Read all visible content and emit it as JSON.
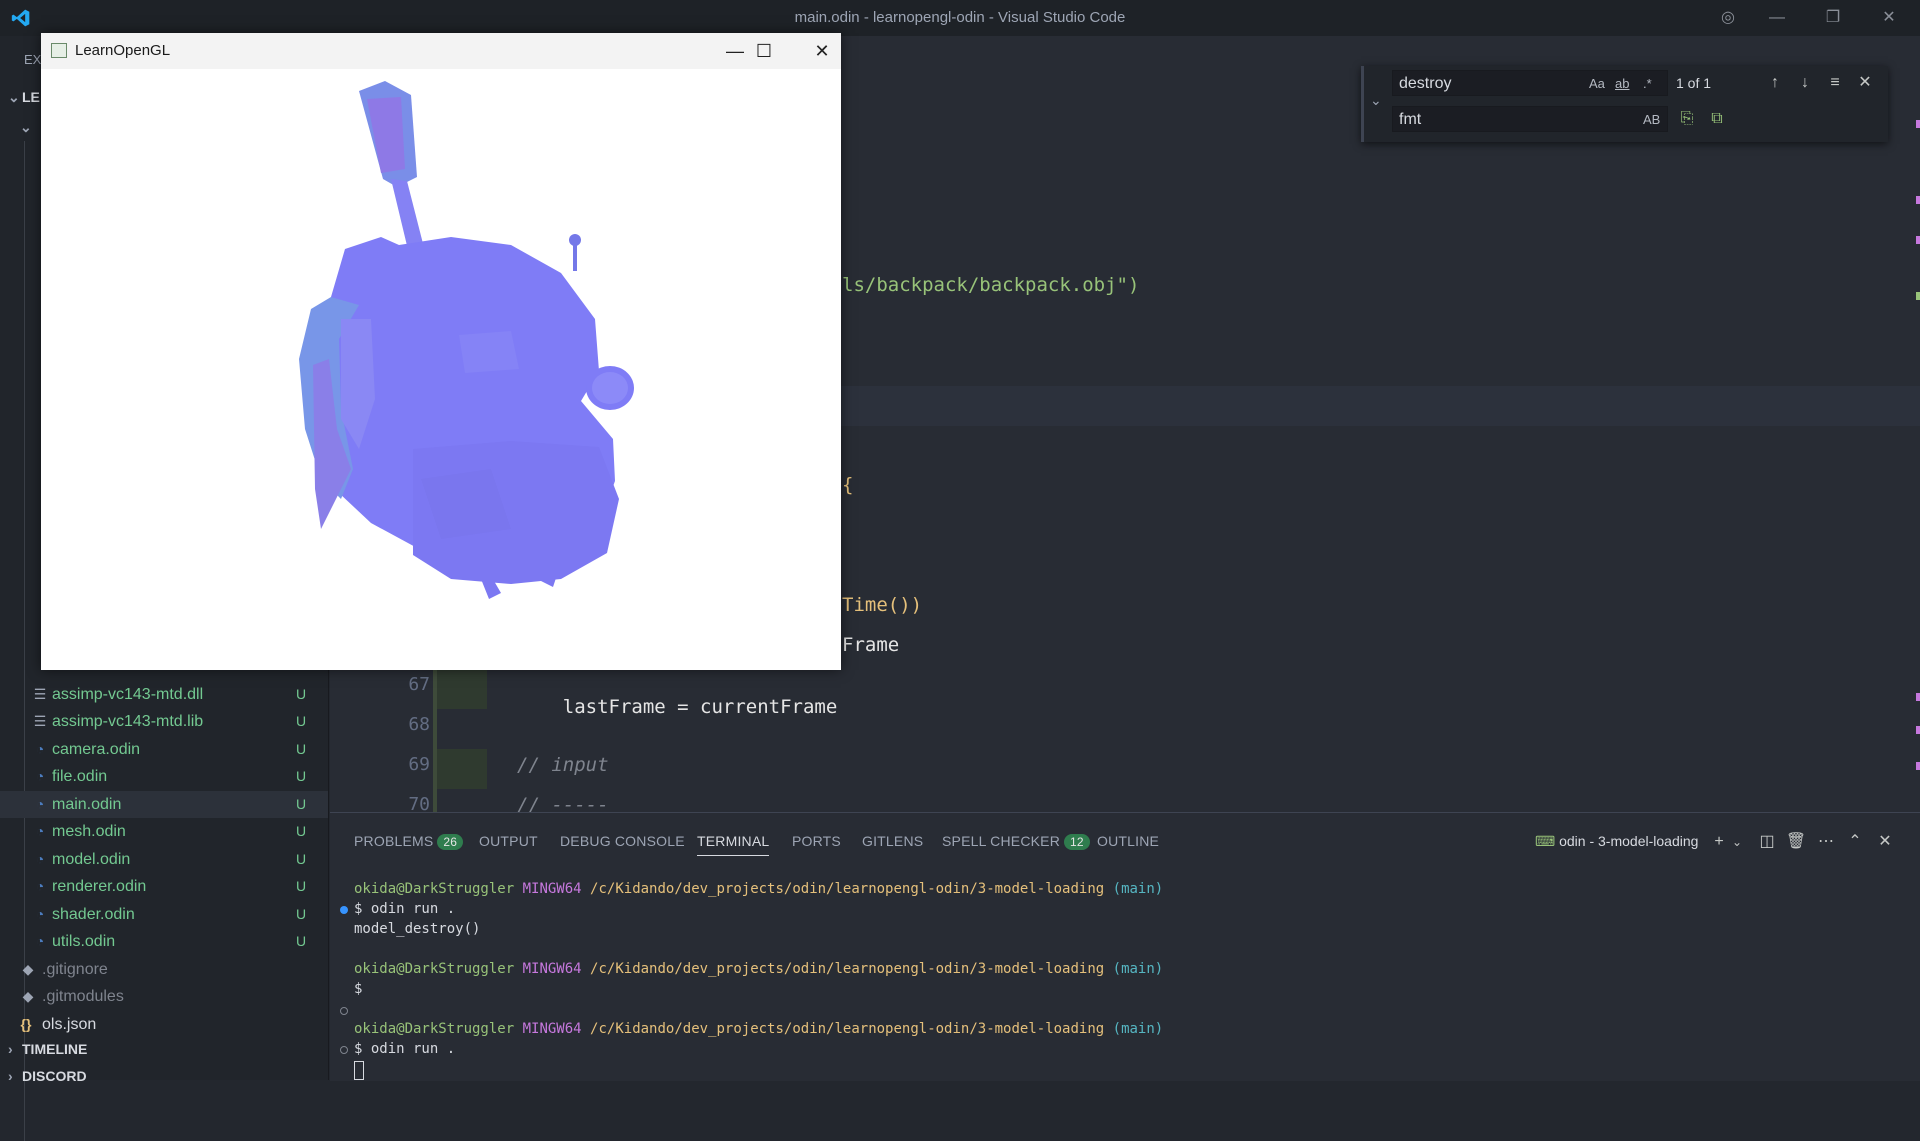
{
  "window": {
    "title": "main.odin - learnopengl-odin - Visual Studio Code"
  },
  "sidebar": {
    "title": "EX",
    "section_prefix": "LE",
    "files": [
      {
        "name": "assimp-vc143-mtd.dll",
        "status": "U",
        "icon": "file-lines-icon"
      },
      {
        "name": "assimp-vc143-mtd.lib",
        "status": "U",
        "icon": "file-lines-icon"
      },
      {
        "name": "camera.odin",
        "status": "U",
        "icon": "odin-icon"
      },
      {
        "name": "file.odin",
        "status": "U",
        "icon": "odin-icon"
      },
      {
        "name": "main.odin",
        "status": "U",
        "icon": "odin-icon",
        "selected": true
      },
      {
        "name": "mesh.odin",
        "status": "U",
        "icon": "odin-icon"
      },
      {
        "name": "model.odin",
        "status": "U",
        "icon": "odin-icon"
      },
      {
        "name": "renderer.odin",
        "status": "U",
        "icon": "odin-icon"
      },
      {
        "name": "shader.odin",
        "status": "U",
        "icon": "odin-icon"
      },
      {
        "name": "utils.odin",
        "status": "U",
        "icon": "odin-icon"
      },
      {
        "name": ".gitignore",
        "status": "",
        "icon": "git-icon"
      },
      {
        "name": ".gitmodules",
        "status": "",
        "icon": "git-icon"
      },
      {
        "name": "ols.json",
        "status": "",
        "icon": "json-icon"
      }
    ],
    "timeline_label": "TIMELINE",
    "discord_label": "DISCORD"
  },
  "editor": {
    "fragments": {
      "path_tail": "ls/backpack/backpack.obj\")",
      "brace": "{",
      "time_call": "Time())",
      "frame": "Frame"
    },
    "lines": [
      {
        "num": "67",
        "code": "lastFrame = currentFrame"
      },
      {
        "num": "68",
        "code": ""
      },
      {
        "num": "69",
        "code": "// input"
      },
      {
        "num": "70",
        "code": "// -----"
      }
    ]
  },
  "find_widget": {
    "search_value": "destroy",
    "replace_value": "fmt",
    "match_case": "Aa",
    "whole_word": "ab",
    "regex": ".*",
    "preserve_case": "AB",
    "result_count": "1 of 1"
  },
  "panel": {
    "tabs": [
      {
        "label": "PROBLEMS",
        "badge": "26"
      },
      {
        "label": "OUTPUT"
      },
      {
        "label": "DEBUG CONSOLE"
      },
      {
        "label": "TERMINAL",
        "active": true
      },
      {
        "label": "PORTS"
      },
      {
        "label": "GITLENS"
      },
      {
        "label": "SPELL CHECKER",
        "badge": "12"
      },
      {
        "label": "OUTLINE"
      }
    ],
    "terminal_name": "odin - 3-model-loading",
    "prompt": {
      "user": "okida@DarkStruggler",
      "host": "MINGW64",
      "path": "/c/Kidando/dev_projects/odin/learnopengl-odin/3-model-loading",
      "branch": "(main)"
    },
    "cmd1": "$ odin run .",
    "out1": "model_destroy()",
    "cmd2": "$",
    "cmd3": "$ odin run ."
  },
  "gl_window": {
    "title": "LearnOpenGL"
  },
  "colors": {
    "accent": "#007acc",
    "untracked": "#73c991",
    "model_fill": "#7f7cf6"
  }
}
